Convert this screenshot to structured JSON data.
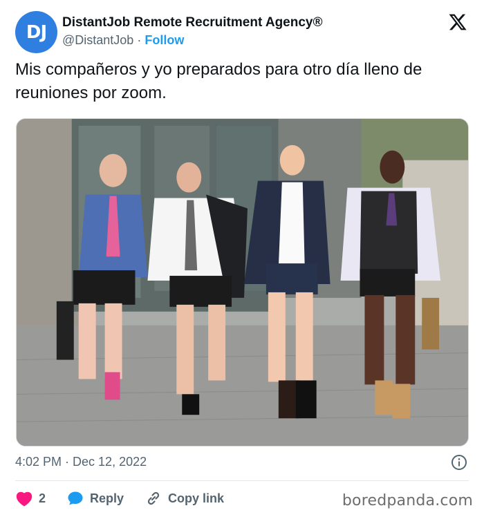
{
  "author": {
    "avatar_text": "DJ",
    "name": "DistantJob Remote Recruitment Agency®",
    "handle": "@DistantJob",
    "separator": "·",
    "follow_label": "Follow"
  },
  "tweet": {
    "text": "Mis compañeros y yo preparados para otro día lleno de reuniones por zoom.",
    "timestamp": "4:02 PM · Dec 12, 2022"
  },
  "actions": {
    "likes": "2",
    "reply_label": "Reply",
    "copy_label": "Copy link"
  },
  "watermark": "boredpanda.com",
  "colors": {
    "accent": "#1d9bf0",
    "heart": "#f91880",
    "avatar": "#2f7fe0"
  },
  "icons": {
    "brand": "x-logo-icon",
    "info": "info-icon",
    "like": "heart-icon",
    "reply": "reply-bubble-icon",
    "copy": "link-icon"
  }
}
